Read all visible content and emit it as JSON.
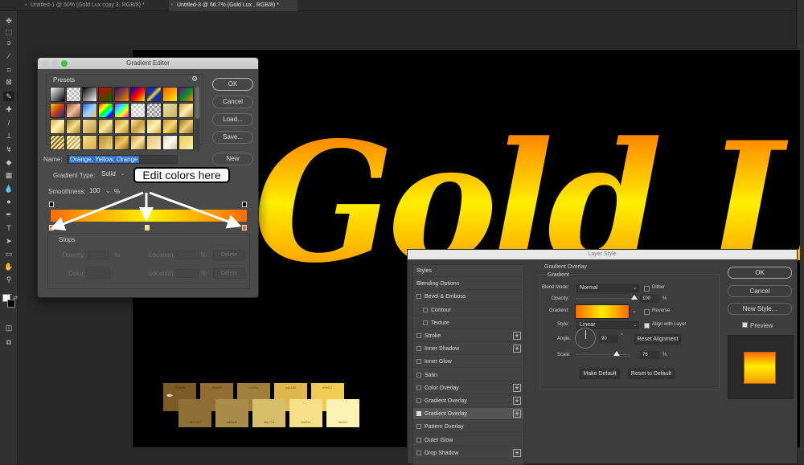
{
  "tabs": [
    {
      "label": "Untitled-1 @ 50% (Gold Lux copy 3, RGB/8) *",
      "active": false
    },
    {
      "label": "Untitled-3 @ 66.7% (Gold Lux , RGB/8) *",
      "active": true
    }
  ],
  "toolbar": {
    "tools": [
      "move-tool",
      "marquee-tool",
      "lasso-tool",
      "quick-select-tool",
      "crop-tool",
      "frame-tool",
      "eyedropper-tool",
      "healing-tool",
      "brush-tool",
      "clone-stamp-tool",
      "history-brush-tool",
      "eraser-tool",
      "gradient-tool",
      "blur-tool",
      "dodge-tool",
      "pen-tool",
      "type-tool",
      "path-select-tool",
      "rectangle-tool",
      "hand-tool",
      "zoom-tool",
      "more-tools"
    ],
    "glyphs": [
      "✥",
      "⬚",
      "ↄ",
      "⁄",
      "⌗",
      "⊠",
      "✎",
      "✚",
      "/",
      "⊥",
      "↯",
      "◆",
      "▦",
      "💧",
      "●",
      "✒",
      "T",
      "➤",
      "▭",
      "✋",
      "⚲",
      "…"
    ],
    "foreground_color": "#ffffff",
    "background_color": "#000000"
  },
  "canvas": {
    "text": "Gold Lux",
    "swatches_top": [
      {
        "label": "7b5a25",
        "color": "#7b5a25"
      },
      {
        "label": "936d33",
        "color": "#936d33"
      },
      {
        "label": "a07f3a",
        "color": "#a07f3a"
      },
      {
        "label": "eac150",
        "color": "#e0b74c"
      },
      {
        "label": "f6d457",
        "color": "#f0cc55"
      }
    ],
    "swatches_bottom": [
      {
        "label": "8e7037",
        "color": "#8e7037"
      },
      {
        "label": "b89a4f",
        "color": "#a98b4a"
      },
      {
        "label": "d6c77a",
        "color": "#d6bd6a"
      },
      {
        "label": "f8e093",
        "color": "#f5e089"
      },
      {
        "label": "fdefb2",
        "color": "#fbf2b4"
      }
    ]
  },
  "gradient_editor": {
    "title": "Gradient Editor",
    "presets_label": "Presets",
    "buttons": {
      "ok": "OK",
      "cancel": "Cancel",
      "load": "Load...",
      "save": "Save...",
      "new": "New"
    },
    "name_label": "Name:",
    "name_value": "Orange, Yellow, Orange",
    "gradient_type_label": "Gradient Type:",
    "gradient_type_value": "Solid",
    "smoothness_label": "Smoothness:",
    "smoothness_value": "100",
    "percent": "%",
    "stops_label": "Stops",
    "opacity_label": "Opacity:",
    "color_label": "Color:",
    "location_label": "Location:",
    "delete_label": "Delete",
    "stop_colors": [
      "#ff6a00",
      "#ffee44",
      "#ff6a00"
    ],
    "preset_swatches": [
      "linear-gradient(135deg,#fff,#000)",
      "repeating-conic-gradient(#eee 0 25%,#bbb 0 50%) 0 0/6px 6px",
      "linear-gradient(135deg,#000,#fff)",
      "linear-gradient(135deg,#d00,#060)",
      "linear-gradient(135deg,#2a0a6a,#ff8800)",
      "linear-gradient(135deg,#0000cc,#ff0000,#ffee00)",
      "linear-gradient(135deg,#1b2fa8 35%,#f2e02a 50%,#1b2fa8 65%)",
      "linear-gradient(135deg,#ff5a00,#ffee00)",
      "linear-gradient(135deg,#7a0aa0,#0a8a2a,#ff8800)",
      "linear-gradient(135deg,#ffd000,#c83c1e,#142896)",
      "linear-gradient(135deg,#8a4a2a,#f2c0a0,#8a4a2a)",
      "linear-gradient(135deg,#1a5ad6,#9ad0ff,#e8c070)",
      "linear-gradient(135deg,red,orange,yellow,lime,cyan,blue,magenta)",
      "linear-gradient(135deg,#f0f,#0ff,#ff0,#f0f)",
      "repeating-conic-gradient(#fff 0 25%,#ccc 0 50%) 0 0/6px 6px",
      "repeating-conic-gradient(#ddd 0 25%,#999 0 50%) 0 0/6px 6px",
      "linear-gradient(135deg,#e8e0b0,#c8b060)",
      "linear-gradient(135deg,#c8a040,#fff0b0,#b08830)",
      "linear-gradient(135deg,#d8b040,#fff4b0,#c89a30)",
      "linear-gradient(135deg,#a07820,#f6e08a,#9c7420)",
      "linear-gradient(135deg,#f2e2a0,#c09a40)",
      "linear-gradient(135deg,#c8a040,#fce9a0,#a88030)",
      "linear-gradient(135deg,#b89030,#f9df80,#b08828)",
      "linear-gradient(135deg,#f8e6a0,#c89c3c,#f8e6a0)",
      "linear-gradient(135deg,#e6c060,#fff1b8,#d4a838)",
      "linear-gradient(135deg,#c89830,#f6d870,#a47a20)",
      "linear-gradient(135deg,#8a6a20,#f0d070,#8a6a20)",
      "repeating-linear-gradient(135deg,#8a6a20 0 2px,#f6e6b0 2px 4px)",
      "repeating-linear-gradient(135deg,#c8a850 0 2px,#fff4cc 2px 4px)",
      "linear-gradient(135deg,#f4dc8a,#d6b050)",
      "linear-gradient(135deg,#b08a30,#f5dc80)",
      "linear-gradient(135deg,#a07a28,#f0c860,#8a6420)",
      "linear-gradient(135deg,#c69a3a,#fae6a0,#b08a30)",
      "linear-gradient(135deg,#e0c070,#fff2c0)",
      "linear-gradient(135deg,#d8d8c8,#fffaf0,#c8c0a8)",
      "linear-gradient(135deg,#e6c860,#fff0a0)"
    ]
  },
  "callout": {
    "text": "Edit colors here"
  },
  "layer_style": {
    "title": "Layer Style",
    "styles": [
      {
        "label": "Styles",
        "checkbox": null,
        "plus": false,
        "indent": 0
      },
      {
        "label": "Blending Options",
        "checkbox": null,
        "plus": false,
        "indent": 0
      },
      {
        "label": "Bevel & Emboss",
        "checkbox": false,
        "plus": false,
        "indent": 0
      },
      {
        "label": "Contour",
        "checkbox": false,
        "plus": false,
        "indent": 1
      },
      {
        "label": "Texture",
        "checkbox": false,
        "plus": false,
        "indent": 1
      },
      {
        "label": "Stroke",
        "checkbox": false,
        "plus": true,
        "indent": 0
      },
      {
        "label": "Inner Shadow",
        "checkbox": false,
        "plus": true,
        "indent": 0
      },
      {
        "label": "Inner Glow",
        "checkbox": false,
        "plus": false,
        "indent": 0
      },
      {
        "label": "Satin",
        "checkbox": false,
        "plus": false,
        "indent": 0
      },
      {
        "label": "Color Overlay",
        "checkbox": false,
        "plus": true,
        "indent": 0
      },
      {
        "label": "Gradient Overlay",
        "checkbox": false,
        "plus": true,
        "indent": 0
      },
      {
        "label": "Gradient Overlay",
        "checkbox": true,
        "plus": true,
        "indent": 0,
        "active": true
      },
      {
        "label": "Pattern Overlay",
        "checkbox": false,
        "plus": false,
        "indent": 0
      },
      {
        "label": "Outer Glow",
        "checkbox": false,
        "plus": false,
        "indent": 0
      },
      {
        "label": "Drop Shadow",
        "checkbox": false,
        "plus": true,
        "indent": 0
      }
    ],
    "section_title": "Gradient Overlay",
    "subsection_title": "Gradient",
    "blend_mode_label": "Blend Mode:",
    "blend_mode_value": "Normal",
    "dither_label": "Dither",
    "dither": false,
    "opacity_label": "Opacity:",
    "opacity_value": "100",
    "opacity_fraction": 1.0,
    "gradient_label": "Gradient:",
    "reverse_label": "Reverse",
    "reverse": false,
    "style_label": "Style:",
    "style_value": "Linear",
    "align_label": "Align with Layer",
    "align": true,
    "angle_label": "Angle:",
    "angle_value": "90",
    "angle_unit": "°",
    "reset_alignment_label": "Reset Alignment",
    "scale_label": "Scale:",
    "scale_value": "76",
    "scale_fraction": 0.76,
    "percent": "%",
    "make_default_label": "Make Default",
    "reset_default_label": "Reset to Default",
    "buttons": {
      "ok": "OK",
      "cancel": "Cancel",
      "new_style": "New Style..."
    },
    "preview_label": "Preview",
    "preview": true
  }
}
